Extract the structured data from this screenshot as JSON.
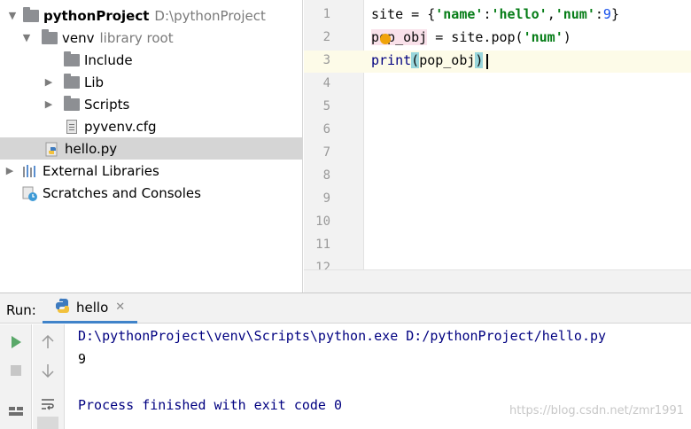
{
  "project_tree": {
    "root": {
      "name": "pythonProject",
      "path": "D:\\pythonProject"
    },
    "venv": {
      "name": "venv",
      "hint": "library root"
    },
    "venv_children": [
      "Include",
      "Lib",
      "Scripts",
      "pyvenv.cfg"
    ],
    "selected_file": "hello.py",
    "external_libraries": "External Libraries",
    "scratches": "Scratches and Consoles"
  },
  "editor": {
    "line_numbers": [
      "1",
      "2",
      "3",
      "4",
      "5",
      "6",
      "7",
      "8",
      "9",
      "10",
      "11",
      "12"
    ],
    "lines": {
      "l1": {
        "a": "site = {",
        "s1": "'name'",
        "c1": ":",
        "s2": "'hello'",
        "c2": ",",
        "s3": "'num'",
        "c3": ":",
        "n": "9",
        "e": "}"
      },
      "l2": {
        "var": "pop_obj",
        "rest": " = site.pop(",
        "s": "'num'",
        "e": ")"
      },
      "l3": {
        "fn": "print",
        "open": "(",
        "arg": "pop_obj",
        "close": ")"
      }
    }
  },
  "run": {
    "label": "Run:",
    "tab": "hello",
    "console": {
      "command": "D:\\pythonProject\\venv\\Scripts\\python.exe D:/pythonProject/hello.py",
      "output": "9",
      "exit": "Process finished with exit code 0"
    }
  },
  "watermark": "https://blog.csdn.net/zmr1991",
  "colors": {
    "accent_tab": "#4083c9",
    "run_green": "#59a869",
    "string": "#067d17",
    "number": "#1750eb"
  }
}
